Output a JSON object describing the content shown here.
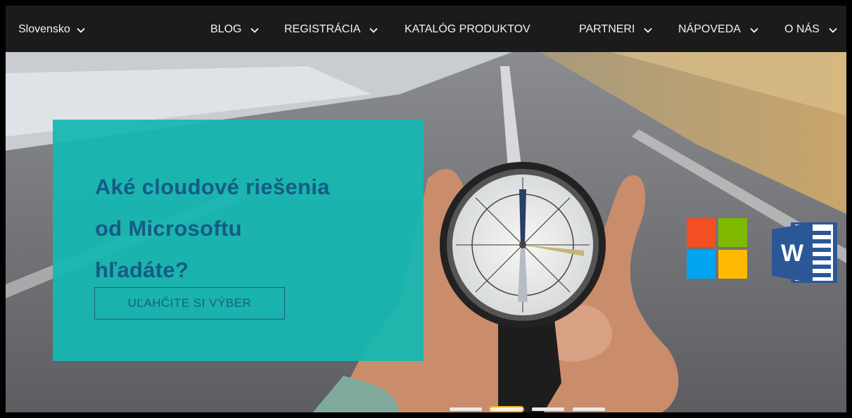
{
  "nav": {
    "country": "Slovensko",
    "items": [
      {
        "label": "BLOG"
      },
      {
        "label": "REGISTRÁCIA"
      },
      {
        "label": "KATALÓG PRODUKTOV"
      },
      {
        "label": "PARTNERI"
      },
      {
        "label": "NÁPOVEDA"
      },
      {
        "label": "O NÁS"
      }
    ]
  },
  "hero": {
    "title_line1": "Aké cloudové riešenia",
    "title_line2": "od Microsoftu",
    "title_line3": "hľadáte?",
    "button_label": "UĽAHČITE SI VÝBER",
    "word_letter": "W"
  },
  "carousel": {
    "slide_count": 4,
    "active_slide": 2
  },
  "colors": {
    "navbar": "#1a1b1c",
    "promo_box": "#14b8b2",
    "promo_text": "#155b85",
    "dot_active_border": "#f0b42a",
    "ms_red": "#f25022",
    "ms_green": "#7fba00",
    "ms_blue": "#00a4ef",
    "ms_yellow": "#ffb900",
    "word_blue": "#2b5797"
  }
}
